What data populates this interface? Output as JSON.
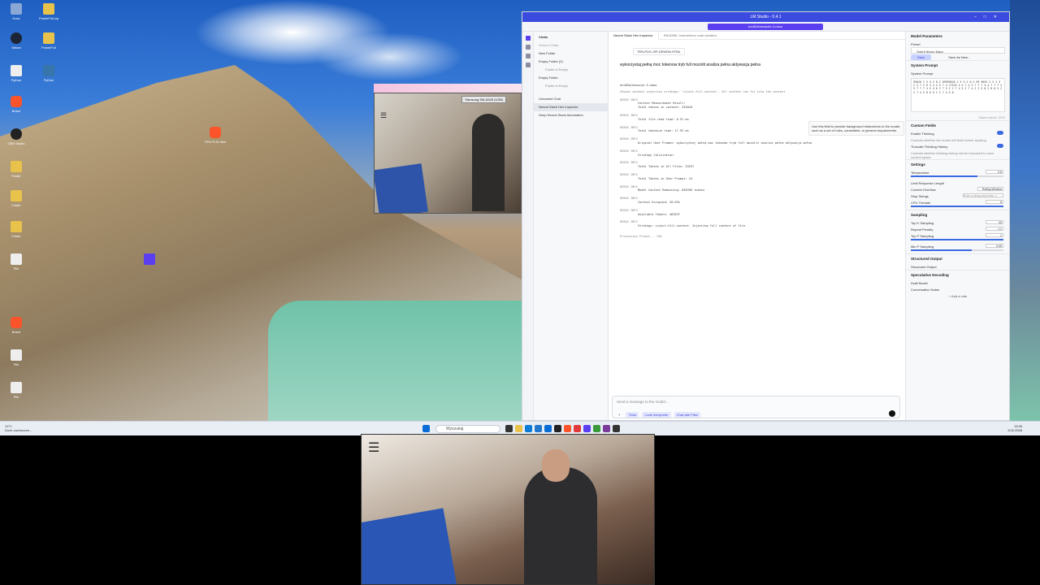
{
  "desktop": {
    "icons": [
      {
        "label": "Kosz"
      },
      {
        "label": "PowerFull.zip"
      },
      {
        "label": "Steam"
      },
      {
        "label": "PowerFull"
      },
      {
        "label": "Brave"
      },
      {
        "label": "Python"
      },
      {
        "label": "Brave"
      },
      {
        "label": "OBS Studio"
      },
      {
        "label": "Folder"
      },
      {
        "label": "Folder"
      },
      {
        "label": "Folder"
      },
      {
        "label": "Plik"
      },
      {
        "label": "Brave"
      },
      {
        "label": "Plik"
      },
      {
        "label": "Plik"
      }
    ],
    "floating_icon": "TEN PLIK.html"
  },
  "taskbar": {
    "weather_temp": "10°C",
    "weather_desc": "Duże zachmurze...",
    "search_placeholder": "Wyszukaj",
    "time": "13:30",
    "date": "3.02.2026"
  },
  "webcam_small": {
    "title": "Samsung SM-A545 (USB)"
  },
  "lmstudio": {
    "window_title": "LM Studio - 0.4.1",
    "model_pill": "ecc82a/newszin-3-nano",
    "sidebar": {
      "header": "Chats",
      "search_placeholder": "Search Chats...",
      "new_folder": "New Folder",
      "items": [
        {
          "label": "Empty Folder (2)",
          "sub": false
        },
        {
          "label": "Folder is Empty",
          "sub": true
        },
        {
          "label": "Empty Folder",
          "sub": false
        },
        {
          "label": "Folder is Empty",
          "sub": true
        },
        {
          "label": "Unnamed Chat",
          "sub": false
        },
        {
          "label": "Neural Stack Hex Inspector",
          "sub": false,
          "active": true
        },
        {
          "label": "Deep Neural Stack Automation",
          "sub": false
        }
      ]
    },
    "tabs": [
      "Neural Stack Hex Inspector",
      "README: Instructions code sandbox"
    ],
    "attachment": "TEN-PLIK-ZIP-DEMON.HTML",
    "user_message": "wykorzystaj pełną moc tokenow tryb full mozolit analiza pełna aktywacja pełna",
    "assistant_name": "ecc82a/newszin-3-nano",
    "context_note": "Chosen context injection strategy: 'inject-full-content'. All content can fit into the context",
    "debug": [
      {
        "h": "DEBUG INFO",
        "t": "Context Measurement Result:"
      },
      {
        "h": "",
        "t": "Total tokens in context: 234010"
      },
      {
        "h": "DEBUG INFO",
        "t": "Total file read time: 6.91 ms"
      },
      {
        "h": "DEBUG INFO",
        "t": "Total tokenize time: 17.92 ms"
      },
      {
        "h": "DEBUG INFO",
        "t": "Original User Prompt: wykorzystaj pełną moc tokenów tryb full mozolit analiza pełna aktywacja pełna"
      },
      {
        "h": "DEBUG INFO",
        "t": "Strategy Calculation:"
      },
      {
        "h": "DEBUG INFO",
        "t": "Total Tokens in All Files: 33257"
      },
      {
        "h": "DEBUG INFO",
        "t": "Total Tokens in User Prompt: 24"
      },
      {
        "h": "DEBUG INFO",
        "t": "Model Context Remaining: 838390 tokens"
      },
      {
        "h": "DEBUG INFO",
        "t": "Context Occupied: 20.69%"
      },
      {
        "h": "DEBUG INFO",
        "t": "Available Tokens: 462037"
      },
      {
        "h": "DEBUG INFO",
        "t": "Strategy: inject-full-content. Injecting full content of file"
      }
    ],
    "processing": "Processing Prompt... 98%",
    "tooltip": "Use this field to provide background instructions to the model, such as a set of rules, constraints, or general requirements.",
    "input_placeholder": "Send a message to the model...",
    "input_tools": {
      "think": "Think",
      "code": "Code Interpreter",
      "chat": "Chat with Files"
    },
    "right": {
      "title": "Model Parameters",
      "preset_label": "Preset",
      "preset_value": "Ozeni Neuro Naco",
      "save": "Save",
      "save_as": "Save As New...",
      "system_prompt_h": "System Prompt",
      "system_prompt_label": "System Prompt",
      "token_count": "Token count: 1974",
      "system_prompt_text": "99028 2 5 5.2 8.2 89999628 2 5 5.2 8.2 99 9653 2 5 2 5 2 3 7 2 6 3 4 4 5 7 4 71525 4 5 7 4 5 7 7 7 4 4 7 7 7 4 5 7 7 7 4 5 4 6 2 7 5 2 2 7 4 5 2 7 4 2 2 5 8 2 8 6 5 2 2 7 4 5 8 6 5 2 2 7 4 5 8",
      "custom_fields_h": "Custom Fields",
      "enable_thinking": "Enable Thinking",
      "enable_thinking_desc": "Controls whether the model will think before replying",
      "truncate": "Truncate Thinking History",
      "truncate_desc": "Controls whether thinking history will be truncated to save context space",
      "settings_h": "Settings",
      "temperature": "Temperature",
      "temperature_v": "0.8",
      "temperature_pct": 0.72,
      "limit": "Limit Response Length",
      "overflow": "Context Overflow",
      "overflow_v": "Rolling Window",
      "stop": "Stop Strings",
      "stop_ph": "Enter a string and press ⏎",
      "cpu": "CPU Threads",
      "cpu_v": "8",
      "cpu_pct": 1.0,
      "sampling_h": "Sampling",
      "topk": "Top K Sampling",
      "topk_v": "40",
      "repeat": "Repeat Penalty",
      "repeat_v": "1.1",
      "topp": "Top P Sampling",
      "topp_v": "1",
      "topp_pct": 1.0,
      "minp": "Min P Sampling",
      "minp_v": "0.05",
      "minp_pct": 0.66,
      "structured_h": "Structured Output",
      "structured": "Structured Output",
      "spec_h": "Speculative Decoding",
      "draft": "Draft Model",
      "conv_notes": "Conversation Notes",
      "add_note": "+ Add a note"
    }
  }
}
